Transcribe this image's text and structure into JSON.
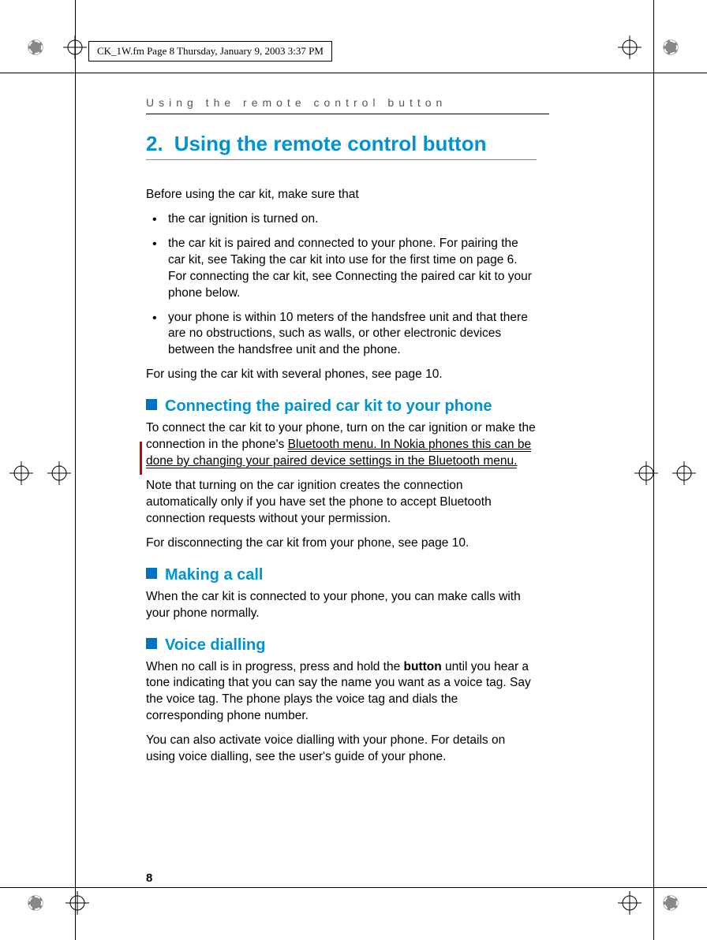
{
  "header_text": "CK_1W.fm  Page 8  Thursday, January 9, 2003  3:37 PM",
  "running_head": "Using the remote control button",
  "chapter": {
    "num": "2.",
    "title": "Using the remote control button"
  },
  "intro": "Before using the car kit, make sure that",
  "bullets": [
    "the car ignition is turned on.",
    "the car kit is paired and connected to your phone. For pairing the car kit, see Taking the car kit into use for the first time on page 6. For connecting the car kit, see Connecting the paired car kit to your phone below.",
    "your phone is within 10 meters of the handsfree unit and that there are no obstructions, such as walls, or other electronic devices between the handsfree unit and the phone."
  ],
  "after_bullets": "For using the car kit with several phones, see page 10.",
  "sec_connect": {
    "title": "Connecting the paired car kit to your phone",
    "p1a": "To connect the car kit to your phone, turn on the car ignition or make the connection in the phone's ",
    "p1b": "Bluetooth menu. In Nokia phones this can be done by changing your paired device settings in the Bluetooth menu.",
    "p2": "Note that turning on the car ignition creates the connection automatically only if you have set the phone to accept Bluetooth connection requests without your permission.",
    "p3": "For disconnecting the car kit from your phone, see page 10."
  },
  "sec_call": {
    "title": "Making a call",
    "p1": "When the car kit is connected to your phone, you can make calls with your phone normally."
  },
  "sec_voice": {
    "title": "Voice dialling",
    "p1a": "When no call is in progress, press and hold the ",
    "p1b": "button",
    "p1c": " until you hear a tone indicating that you can say the name you want as a voice tag. Say the voice tag. The phone plays the voice tag and dials the corresponding phone number.",
    "p2": "You can also activate voice dialling with your phone. For details on using voice dialling, see the user's guide of your phone."
  },
  "page_num": "8"
}
